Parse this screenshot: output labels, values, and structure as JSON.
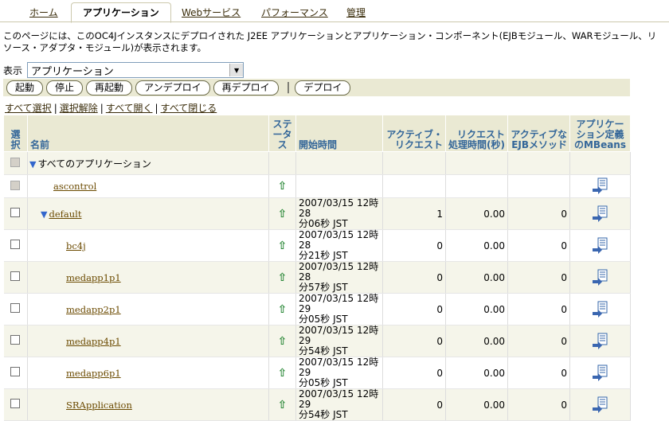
{
  "tabs": [
    {
      "label": "ホーム",
      "active": false
    },
    {
      "label": "アプリケーション",
      "active": true
    },
    {
      "label": "Webサービス",
      "active": false
    },
    {
      "label": "パフォーマンス",
      "active": false
    },
    {
      "label": "管理",
      "active": false
    }
  ],
  "description": "このページには、このOC4Jインスタンスにデプロイされた J2EE アプリケーションとアプリケーション・コンポーネント(EJBモジュール、WARモジュール、リソース・アダプタ・モジュール)が表示されます。",
  "view": {
    "label": "表示",
    "selected": "アプリケーション"
  },
  "buttons": {
    "start": "起動",
    "stop": "停止",
    "restart": "再起動",
    "undeploy": "アンデプロイ",
    "redeploy": "再デプロイ",
    "deploy": "デプロイ"
  },
  "links": {
    "select_all": "すべて選択",
    "deselect": "選択解除",
    "expand_all": "すべて開く",
    "collapse_all": "すべて閉じる"
  },
  "headers": {
    "select": "選択",
    "name": "名前",
    "status": "ステータス",
    "start_time": "開始時間",
    "active_requests": "アクティブ・リクエスト",
    "request_time": "リクエスト処理時間(秒)",
    "active_ejb": "アクティブなEJBメソッド",
    "mbeans": "アプリケーション定義のMBeans"
  },
  "rows": [
    {
      "name": "すべてのアプリケーション",
      "level": 0,
      "expand": true,
      "link": false,
      "status": "",
      "time1": "",
      "time2": "",
      "active": "",
      "req": "",
      "ejb": "",
      "mbean": false,
      "cb_disabled": true
    },
    {
      "name": "ascontrol",
      "level": 1,
      "expand": false,
      "link": true,
      "status": "⇧",
      "time1": "",
      "time2": "",
      "active": "",
      "req": "",
      "ejb": "",
      "mbean": true,
      "cb_disabled": true
    },
    {
      "name": "default",
      "level": 1,
      "expand": true,
      "link": true,
      "status": "⇧",
      "time1": "2007/03/15 12時28",
      "time2": "分06秒 JST",
      "active": "1",
      "req": "0.00",
      "ejb": "0",
      "mbean": true,
      "cb_disabled": false
    },
    {
      "name": "bc4j",
      "level": 2,
      "expand": false,
      "link": true,
      "status": "⇧",
      "time1": "2007/03/15 12時28",
      "time2": "分21秒 JST",
      "active": "0",
      "req": "0.00",
      "ejb": "0",
      "mbean": true,
      "cb_disabled": false
    },
    {
      "name": "medapp1p1",
      "level": 2,
      "expand": false,
      "link": true,
      "status": "⇧",
      "time1": "2007/03/15 12時28",
      "time2": "分57秒 JST",
      "active": "0",
      "req": "0.00",
      "ejb": "0",
      "mbean": true,
      "cb_disabled": false
    },
    {
      "name": "medapp2p1",
      "level": 2,
      "expand": false,
      "link": true,
      "status": "⇧",
      "time1": "2007/03/15 12時29",
      "time2": "分05秒 JST",
      "active": "0",
      "req": "0.00",
      "ejb": "0",
      "mbean": true,
      "cb_disabled": false
    },
    {
      "name": "medapp4p1",
      "level": 2,
      "expand": false,
      "link": true,
      "status": "⇧",
      "time1": "2007/03/15 12時29",
      "time2": "分54秒 JST",
      "active": "0",
      "req": "0.00",
      "ejb": "0",
      "mbean": true,
      "cb_disabled": false
    },
    {
      "name": "medapp6p1",
      "level": 2,
      "expand": false,
      "link": true,
      "status": "⇧",
      "time1": "2007/03/15 12時29",
      "time2": "分05秒 JST",
      "active": "0",
      "req": "0.00",
      "ejb": "0",
      "mbean": true,
      "cb_disabled": false
    },
    {
      "name": "SRApplication",
      "level": 2,
      "expand": false,
      "link": true,
      "status": "⇧",
      "time1": "2007/03/15 12時29",
      "time2": "分54秒 JST",
      "active": "0",
      "req": "0.00",
      "ejb": "0",
      "mbean": true,
      "cb_disabled": false
    }
  ]
}
